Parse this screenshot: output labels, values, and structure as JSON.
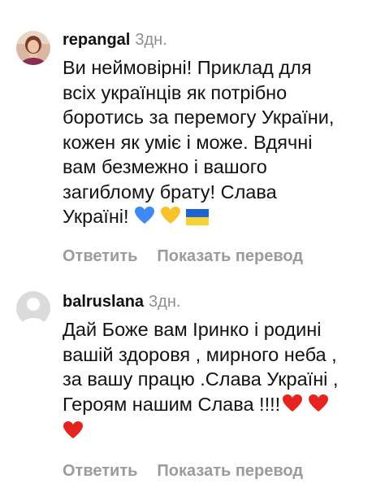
{
  "comments": [
    {
      "username": "repangal",
      "time": "3дн.",
      "text_lines": [
        "Ви неймовірні! Приклад для",
        "всіх українців як  потрібно",
        "боротись за перемогу України,",
        "кожен як уміє і може. Вдячні",
        "вам безмежно і вашого",
        "загиблому брату! Слава",
        "Україні!"
      ],
      "emojis": [
        "blue-heart",
        "yellow-heart",
        "ukraine-flag"
      ],
      "reply_label": "Ответить",
      "translate_label": "Показать перевод"
    },
    {
      "username": "balruslana",
      "time": "3дн.",
      "text_lines": [
        "Дай  Боже вам Іринко і родині",
        "вашій здоровя , мирного неба ,",
        "за вашу працю .Слава Україні ,",
        "Героям нашим Слава !!!!",
        ""
      ],
      "emojis": [
        "red-heart",
        "red-heart",
        "red-heart"
      ],
      "reply_label": "Ответить",
      "translate_label": "Показать перевод"
    }
  ],
  "colors": {
    "text": "#111111",
    "muted": "#8e8e8e",
    "action": "#9b9b9b",
    "heart_blue": "#3d8af7",
    "heart_yellow": "#f8c22c",
    "heart_red": "#e5231f",
    "flag_blue": "#1f63d6",
    "flag_yellow": "#f7d235"
  }
}
